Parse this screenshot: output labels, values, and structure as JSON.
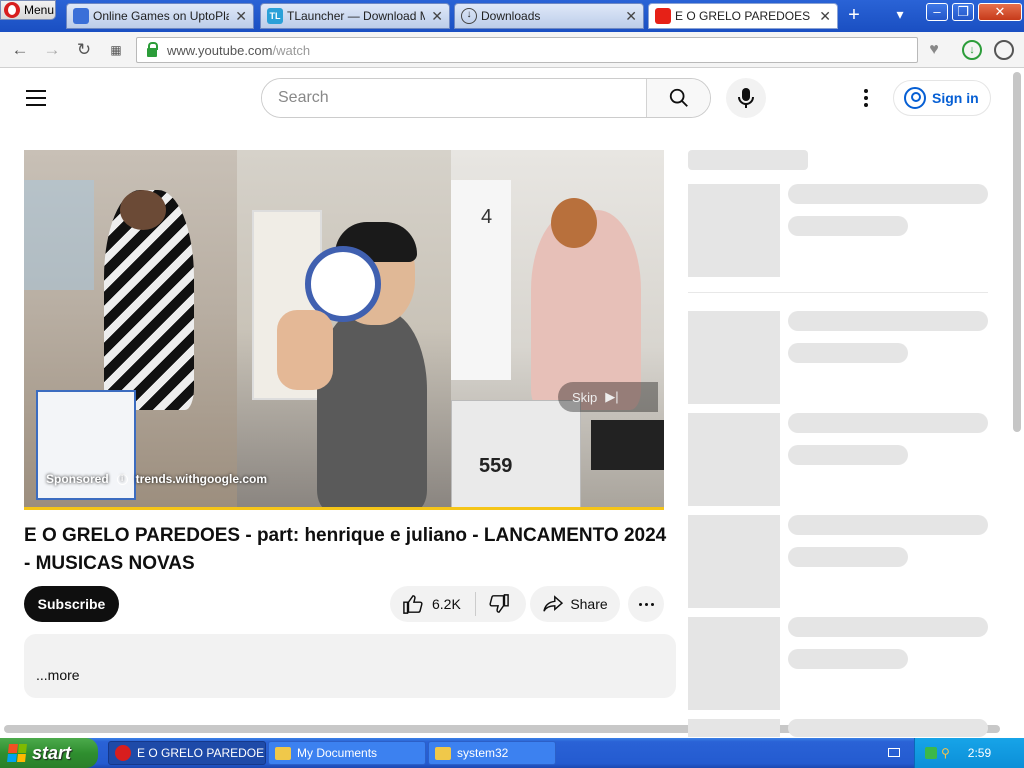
{
  "browser": {
    "menu_label": "Menu",
    "tabs": [
      {
        "label": "Online Games on UptoPlay —",
        "icon": "gamepad-icon"
      },
      {
        "label": "TLauncher — Download Mine",
        "icon": "tlauncher-icon"
      },
      {
        "label": "Downloads",
        "icon": "download-icon"
      },
      {
        "label": "E O GRELO PAREDOES - part",
        "icon": "youtube-icon"
      }
    ],
    "url": {
      "domain": "www.youtube.com",
      "path": "/watch"
    }
  },
  "youtube": {
    "search_placeholder": "Search",
    "sign_in": "Sign in",
    "ad": {
      "sponsored": "Sponsored",
      "advertiser": "trends.withgoogle.com",
      "skip": "Skip"
    },
    "video_title": "E O GRELO PAREDOES - part: henrique e juliano - LANCAMENTO 2024 - MUSICAS NOVAS",
    "subscribe": "Subscribe",
    "likes": "6.2K",
    "share": "Share",
    "description_more": "...more"
  },
  "taskbar": {
    "start": "start",
    "tasks": [
      {
        "label": "E O GRELO PAREDOE...",
        "icon": "opera-icon"
      },
      {
        "label": "My Documents",
        "icon": "folder-icon"
      },
      {
        "label": "system32",
        "icon": "folder-icon"
      }
    ],
    "clock": "2:59"
  },
  "colors": {
    "accent": "#065fd4",
    "progress": "#f5c518",
    "taskbar": "#245bd0"
  }
}
